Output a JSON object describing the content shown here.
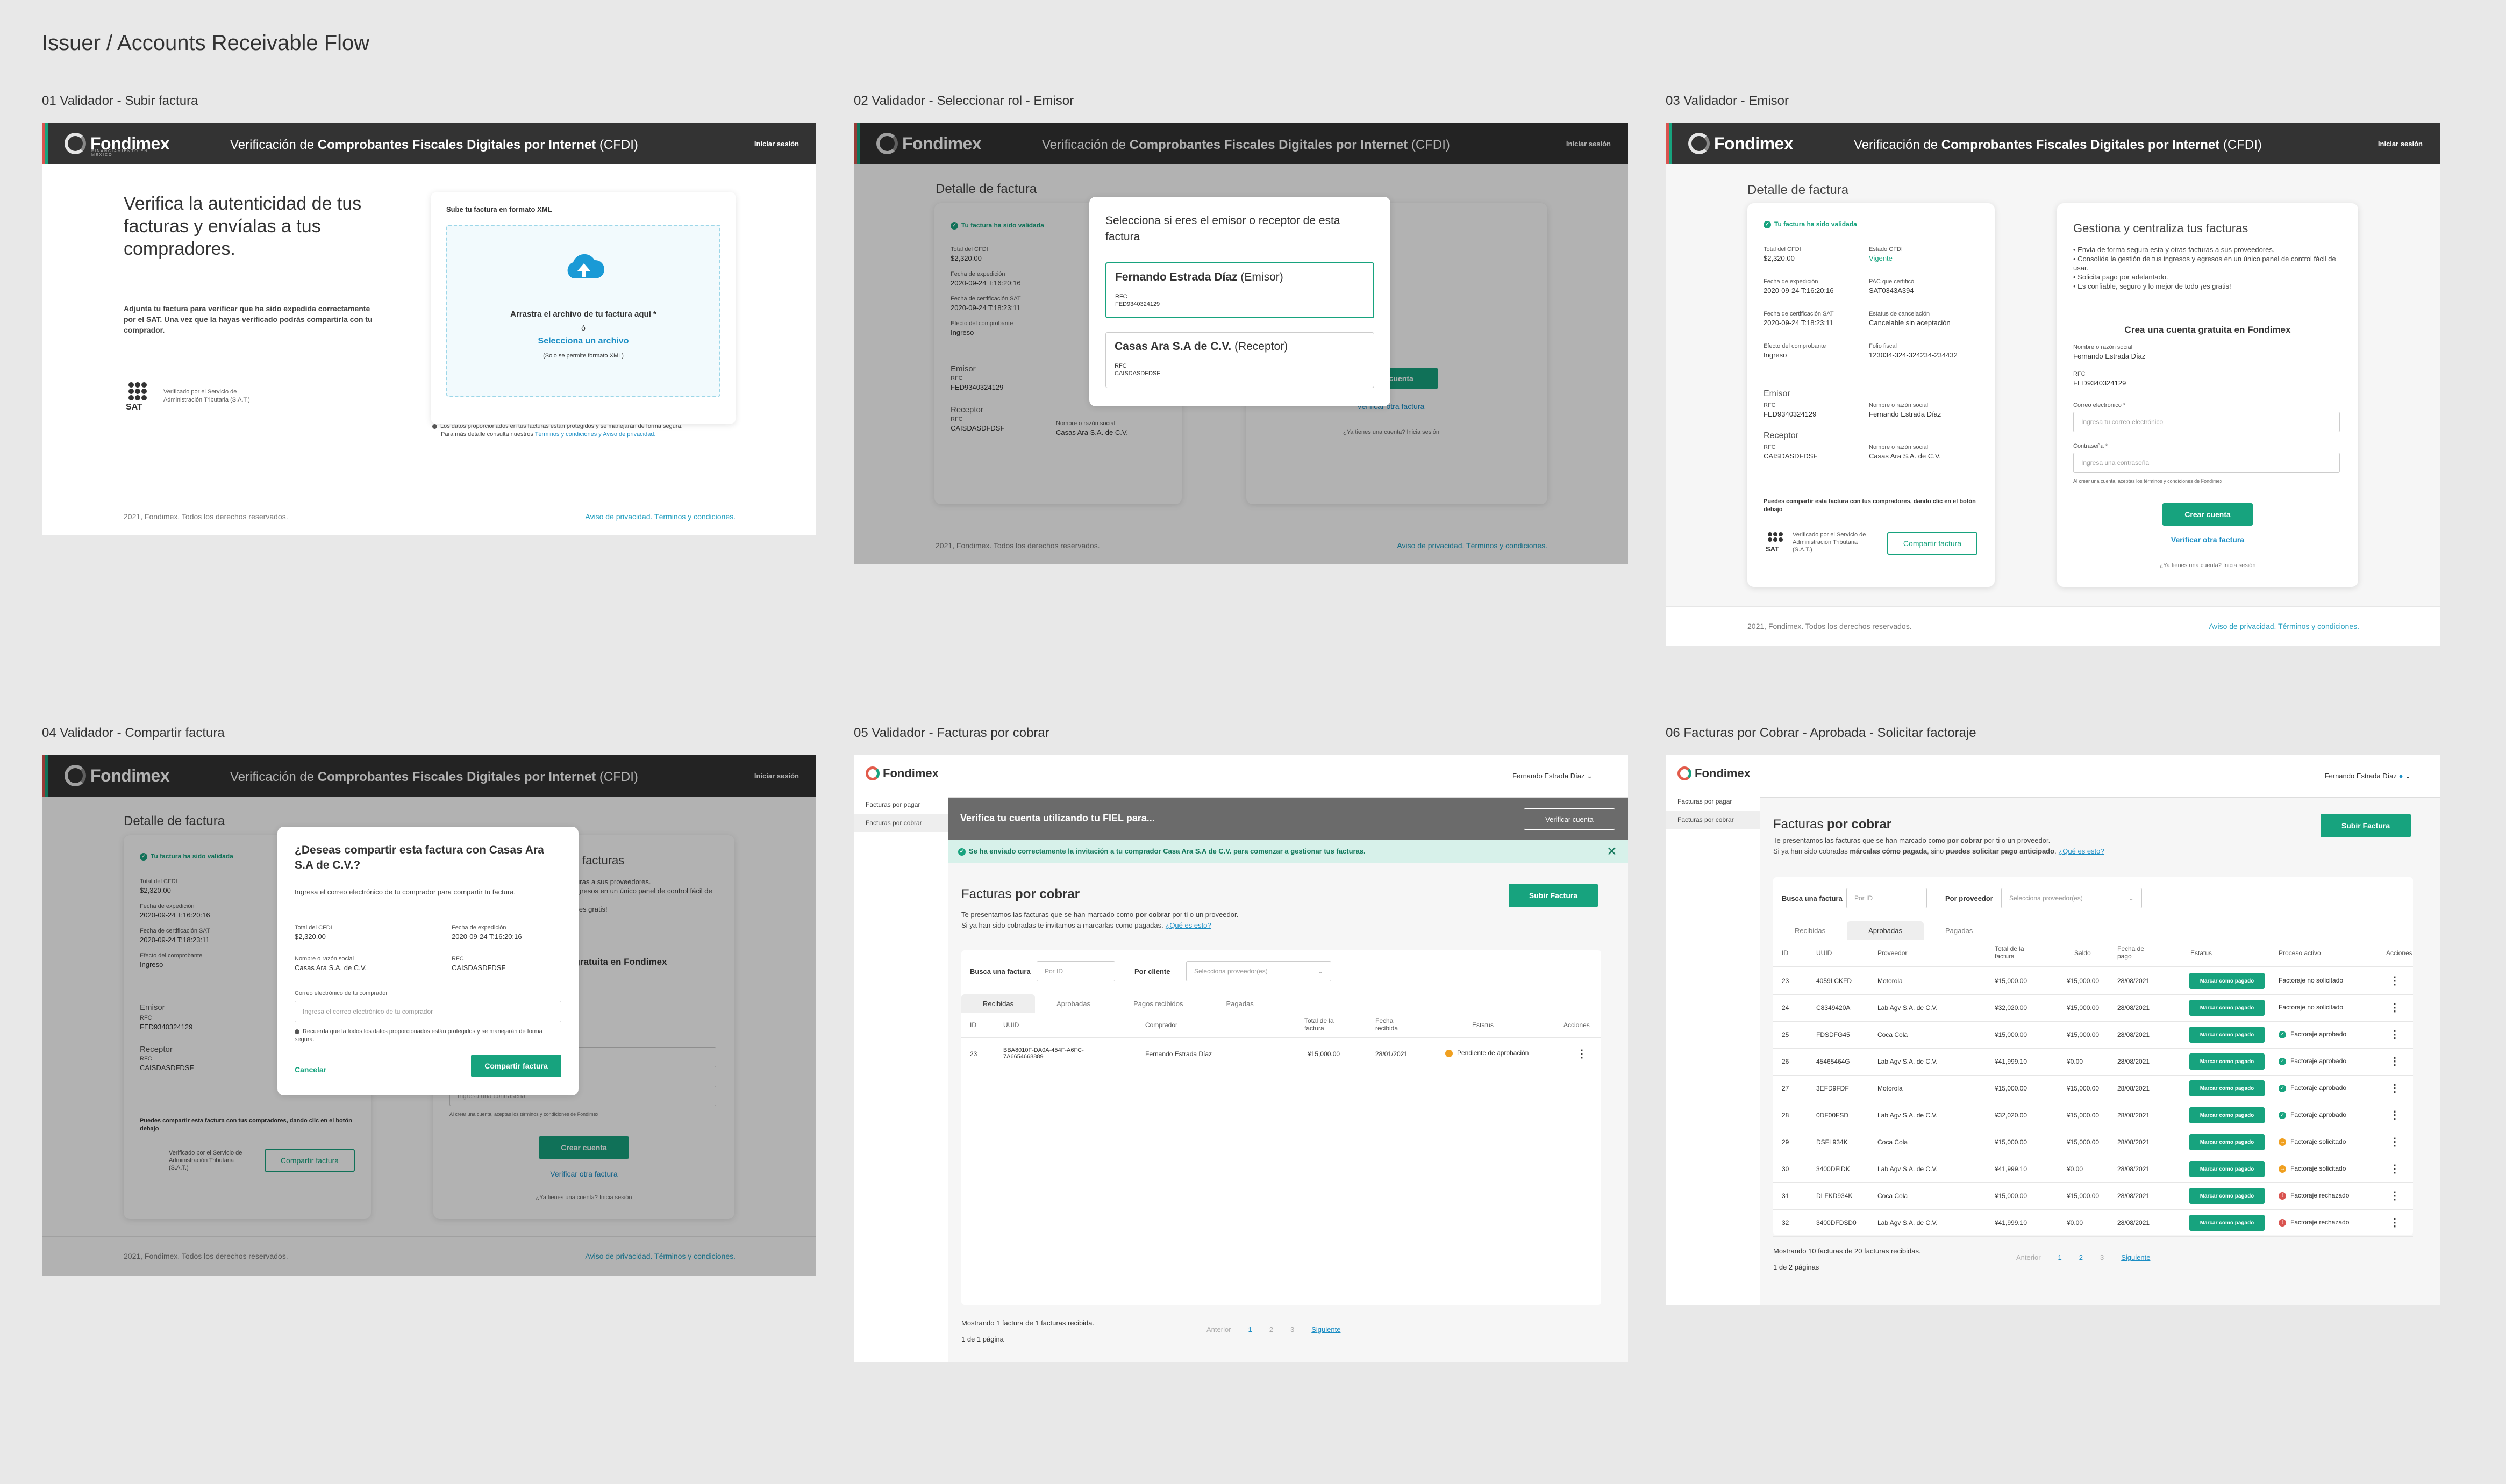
{
  "page_title": "Issuer / Accounts Receivable Flow",
  "brand": {
    "name": "Fondimex",
    "sub": "FINANCIAMIENTO EN MEXICO"
  },
  "header": {
    "title_pre": "Verificación de ",
    "title_bold": "Comprobantes Fiscales Digitales por Internet",
    "title_post": " (CFDI)",
    "login": "Iniciar sesión"
  },
  "footer": {
    "copyright": "2021, Fondimex. Todos los derechos reservados.",
    "links": "Aviso de privacidad. Términos y condiciones."
  },
  "colors": {
    "accent": "#17a37e",
    "link": "#1a8dc4",
    "header": "#333333",
    "stripe_green": "#17a37e",
    "stripe_red": "#d9534f"
  },
  "boards": [
    "01 Validador - Subir factura",
    "02 Validador - Seleccionar rol - Emisor",
    "03 Validador - Emisor",
    "04 Validador -  Compartir factura",
    "05 Validador - Facturas por cobrar",
    "06 Facturas por Cobrar - Aprobada - Solicitar factoraje"
  ],
  "upload": {
    "headline": "Verifica la autenticidad de tus facturas y envíalas a tus compradores.",
    "body": "Adjunta tu factura para verificar que ha sido expedida correctamente por el SAT. Una vez que la hayas verificado podrás compartirla con tu comprador.",
    "sat_text": "Verificado por el Servicio de Administración Tributaria (S.A.T.)",
    "card_title": "Sube tu factura en formato XML",
    "drop_text": "Arrastra el archivo de tu factura aquí *",
    "or": "ó",
    "select_link": "Selecciona un archivo",
    "note": "(Solo se permite formato XML)",
    "privacy": "Los datos proporcionados en tus facturas están protegidos y se manejarán de forma segura.",
    "privacy2_pre": "Para más detalle consulta nuestros ",
    "privacy2_link": "Términos y condiciones y Aviso de privacidad."
  },
  "detail": {
    "title": "Detalle de factura",
    "valid": "Tu factura ha sido validada",
    "total_l": "Total del CFDI",
    "total_v": "$2,320.00",
    "estado_l": "Estado CFDI",
    "estado_v": "Vigente",
    "fexp_l": "Fecha de expedición",
    "fexp_v": "2020-09-24 T:16:20:16",
    "pac_l": "PAC que certificó",
    "pac_v": "SAT0343A394",
    "fcert_l": "Fecha de certificación SAT",
    "fcert_v": "2020-09-24 T:18:23:11",
    "cancel_l": "Estatus de cancelación",
    "cancel_v": "Cancelable sin aceptación",
    "efecto_l": "Efecto del comprobante",
    "efecto_v": "Ingreso",
    "folio_l": "Folio fiscal",
    "folio_v": "123034-324-324234-234432",
    "emisor_h": "Emisor",
    "rfc_l": "RFC",
    "emisor_rfc": "FED9340324129",
    "nombre_l": "Nombre o razón social",
    "emisor_name": "Fernando Estrada Díaz",
    "receptor_h": "Receptor",
    "receptor_rfc": "CAISDASDFDSF",
    "receptor_name": "Casas Ara S.A. de C.V.",
    "share_note": "Puedes compartir esta factura con tus compradores, dando clic en el botón debajo",
    "share_btn": "Compartir factura"
  },
  "signup": {
    "title": "Gestiona y centraliza tus facturas",
    "bullets": [
      "• Envía de forma segura esta y otras facturas a sus proveedores.",
      "• Consolida la gestión de tus ingresos y egresos en un único panel de control fácil de usar.",
      "• Solicita pago por adelantado.",
      "• Es confiable, seguro y lo mejor de todo ¡es gratis!"
    ],
    "cta_title": "Crea una cuenta gratuita en Fondimex",
    "name_l": "Nombre o razón social",
    "name_v": "Fernando Estrada Díaz",
    "rfc_l": "RFC",
    "rfc_v": "FED9340324129",
    "email_l": "Correo electrónico *",
    "email_ph": "Ingresa tu correo electrónico",
    "pwd_l": "Contraseña *",
    "pwd_ph": "Ingresa una contraseña",
    "terms": "Al crear una cuenta, aceptas los términos y condiciones de Fondimex",
    "create_btn": "Crear cuenta",
    "verify_other": "Verificar otra factura",
    "have_account": "¿Ya tienes una cuenta? Inicia sesión"
  },
  "role_modal": {
    "title": "Selecciona si eres el emisor o receptor de esta factura",
    "opt1_name": "Fernando Estrada Díaz",
    "opt1_role": "(Emisor)",
    "opt1_rfc": "FED9340324129",
    "opt2_name": "Casas Ara S.A de C.V.",
    "opt2_role": "(Receptor)",
    "opt2_rfc": "CAISDASDFDSF",
    "rfc": "RFC"
  },
  "share_modal": {
    "title": "¿Deseas compartir esta factura con Casas Ara S.A de C.V.?",
    "desc": "Ingresa el correo electrónico de tu comprador para compartir tu factura.",
    "total_l": "Total del CFDI",
    "total_v": "$2,320.00",
    "fexp_l": "Fecha de expedición",
    "fexp_v": "2020-09-24 T:16:20:16",
    "name_l": "Nombre o razón social",
    "name_v": "Casas Ara S.A. de C.V.",
    "rfc_l": "RFC",
    "rfc_v": "CAISDASDFDSF",
    "email_l": "Correo electrónico de tu comprador",
    "email_ph": "Ingresa el correo electrónico de tu comprador",
    "remember": "Recuerda que la todos los datos proporcionados están protegidos y se manejarán de forma segura.",
    "cancel": "Cancelar",
    "share": "Compartir factura"
  },
  "app": {
    "user": "Fernando Estrada Díaz",
    "nav": [
      "Facturas por pagar",
      "Facturas por cobrar"
    ],
    "fiel_banner": "Verifica tu cuenta utilizando tu FIEL para...",
    "verify_btn": "Verificar cuenta",
    "invite_ok": "Se ha enviado correctamente la invitación a tu comprador Casa Ara S.A de C.V. para comenzar a gestionar tus facturas.",
    "title_pre": "Facturas ",
    "title_bold": "por cobrar",
    "desc1_pre": "Te presentamos las facturas que se han marcado como ",
    "desc1_bold": "por cobrar",
    "desc1_post": " por ti o un proveedor.",
    "desc2_pre": "Si ya han sido cobradas te invitamos a marcarlas como pagadas. ",
    "desc2_link": "¿Qué es esto?",
    "desc3_pre": "Si ya han sido cobradas ",
    "desc3_bold": "márcalas cómo pagada",
    "desc3_mid": ", sino ",
    "desc3_bold2": "puedes solicitar pago anticipado",
    "desc3_post": ". ",
    "upload_btn": "Subir Factura",
    "search_l": "Busca una factura",
    "search_ph": "Por ID",
    "client_l": "Por cliente",
    "client_ph": "Selecciona proveedor(es)",
    "prov_l": "Por proveedor",
    "tabs5": [
      "Recibidas",
      "Aprobadas",
      "Pagos recibidos",
      "Pagadas"
    ],
    "tabs6": [
      "Recibidas",
      "Aprobadas",
      "Pagadas"
    ],
    "cols5": [
      "ID",
      "UUID",
      "Comprador",
      "Total de la factura",
      "Fecha recibida",
      "Estatus",
      "Acciones"
    ],
    "row5": {
      "id": "23",
      "uuid": "BBA8010F-DA0A-454F-A6FC-7A6654668889",
      "buyer": "Fernando Estrada Díaz",
      "total": "¥15,000.00",
      "date": "28/01/2021",
      "status": "Pendiente de aprobación"
    },
    "showing5": "Mostrando 1 factura de 1 facturas recibida.",
    "pages5": "1 de 1 página",
    "pager": {
      "prev": "Anterior",
      "p1": "1",
      "p2": "2",
      "p3": "3",
      "next": "Siguiente"
    },
    "cols6": [
      "ID",
      "UUID",
      "Proveedor",
      "Total de la factura",
      "Saldo",
      "Fecha de pago",
      "Estatus",
      "Proceso activo",
      "Acciones"
    ],
    "mark_paid": "Marcar como pagado",
    "rows6": [
      {
        "id": "23",
        "uuid": "4059LCKFD",
        "prov": "Motorola",
        "total": "¥15,000.00",
        "saldo": "¥15,000.00",
        "date": "28/08/2021",
        "proc": "Factoraje no solicitado",
        "kind": "none"
      },
      {
        "id": "24",
        "uuid": "C8349420A",
        "prov": "Lab Agv S.A. de C.V.",
        "total": "¥32,020.00",
        "saldo": "¥15,000.00",
        "date": "28/08/2021",
        "proc": "Factoraje no solicitado",
        "kind": "none"
      },
      {
        "id": "25",
        "uuid": "FDSDFG45",
        "prov": "Coca Cola",
        "total": "¥15,000.00",
        "saldo": "¥15,000.00",
        "date": "28/08/2021",
        "proc": "Factoraje aprobado",
        "kind": "ok"
      },
      {
        "id": "26",
        "uuid": "45465464G",
        "prov": "Lab Agv S.A. de C.V.",
        "total": "¥41,999.10",
        "saldo": "¥0.00",
        "date": "28/08/2021",
        "proc": "Factoraje aprobado",
        "kind": "ok"
      },
      {
        "id": "27",
        "uuid": "3EFD9FDF",
        "prov": "Motorola",
        "total": "¥15,000.00",
        "saldo": "¥15,000.00",
        "date": "28/08/2021",
        "proc": "Factoraje aprobado",
        "kind": "ok"
      },
      {
        "id": "28",
        "uuid": "0DF00FSD",
        "prov": "Lab Agv S.A. de C.V.",
        "total": "¥32,020.00",
        "saldo": "¥15,000.00",
        "date": "28/08/2021",
        "proc": "Factoraje aprobado",
        "kind": "ok"
      },
      {
        "id": "29",
        "uuid": "DSFL934K",
        "prov": "Coca Cola",
        "total": "¥15,000.00",
        "saldo": "¥15,000.00",
        "date": "28/08/2021",
        "proc": "Factoraje solicitado",
        "kind": "req"
      },
      {
        "id": "30",
        "uuid": "3400DFIDK",
        "prov": "Lab Agv S.A. de C.V.",
        "total": "¥41,999.10",
        "saldo": "¥0.00",
        "date": "28/08/2021",
        "proc": "Factoraje solicitado",
        "kind": "req"
      },
      {
        "id": "31",
        "uuid": "DLFKD934K",
        "prov": "Coca Cola",
        "total": "¥15,000.00",
        "saldo": "¥15,000.00",
        "date": "28/08/2021",
        "proc": "Factoraje rechazado",
        "kind": "rej"
      },
      {
        "id": "32",
        "uuid": "3400DFDSD0",
        "prov": "Lab Agv S.A. de C.V.",
        "total": "¥41,999.10",
        "saldo": "¥0.00",
        "date": "28/08/2021",
        "proc": "Factoraje rechazado",
        "kind": "rej"
      }
    ],
    "showing6": "Mostrando 10 facturas de 20 facturas recibidas.",
    "pages6": "1 de 2 páginas"
  }
}
